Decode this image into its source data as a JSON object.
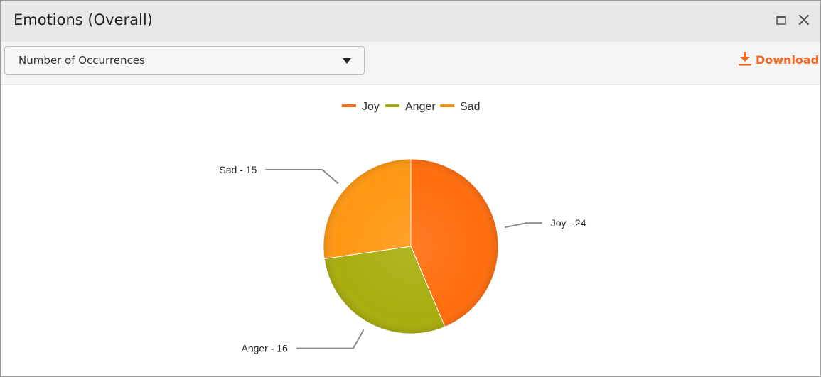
{
  "window": {
    "title": "Emotions (Overall)",
    "maximize_icon": "maximize-icon",
    "close_icon": "close-icon"
  },
  "toolbar": {
    "metric_select": {
      "selected": "Number of Occurrences",
      "icon": "caret-down-icon"
    },
    "download": {
      "label": "Download",
      "icon": "download-icon",
      "color": "#f26722"
    }
  },
  "chart_data": {
    "type": "pie",
    "legend_position": "top-center",
    "slices": [
      {
        "label": "Joy",
        "value": 24,
        "color": "#ff6d0d",
        "data_label": "Joy - 24"
      },
      {
        "label": "Anger",
        "value": 16,
        "color": "#a8ad0e",
        "data_label": "Anger - 16"
      },
      {
        "label": "Sad",
        "value": 15,
        "color": "#ff9712",
        "data_label": "Sad - 15"
      }
    ]
  }
}
